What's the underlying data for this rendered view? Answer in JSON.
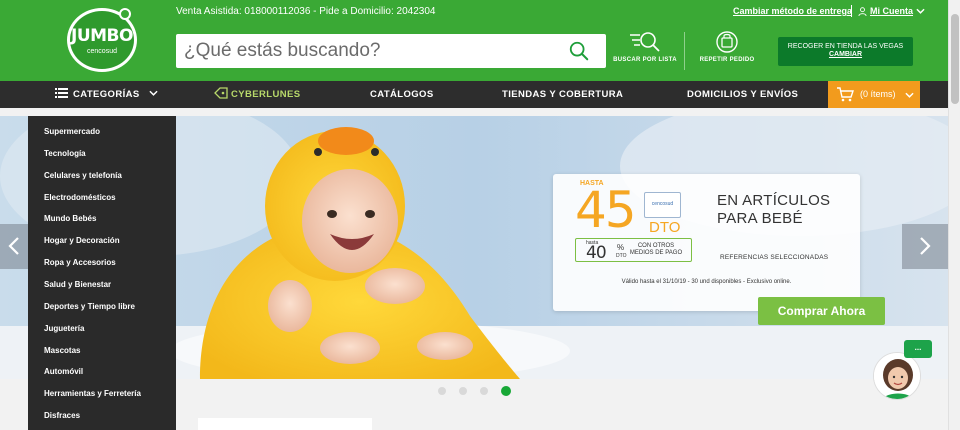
{
  "header": {
    "logo_text": "JUMBO",
    "logo_sub": "cencosud",
    "contact": "Venta Asistida: 018000112036 - Pide a Domicilio: 2042304",
    "delivery_link": "Cambiar método de entrega",
    "account_label": "Mi Cuenta",
    "search_placeholder": "¿Qué estás buscando?",
    "buy_by_list": "BUSCAR POR LISTA",
    "repeat_order": "REPETIR PEDIDO",
    "pickup_title": "RECOGER EN TIENDA LAS VEGAS",
    "pickup_change": "CAMBIAR"
  },
  "nav": {
    "categories": "CATEGORÍAS",
    "cyberlunes": "CYBERLUNES",
    "catalogs": "CATÁLOGOS",
    "stores": "TIENDAS Y COBERTURA",
    "delivery": "DOMICILIOS Y ENVÍOS",
    "cart": "(0 ítems)"
  },
  "sidebar": {
    "items": [
      "Supermercado",
      "Tecnología",
      "Celulares y telefonía",
      "Electrodomésticos",
      "Mundo Bebés",
      "Hogar y Decoración",
      "Ropa y Accesorios",
      "Salud y Bienestar",
      "Deportes y Tiempo libre",
      "Juguetería",
      "Mascotas",
      "Automóvil",
      "Herramientas y Ferretería",
      "Disfraces"
    ]
  },
  "promo": {
    "hasta": "HASTA",
    "big_percent": "45",
    "badge": "cencosud",
    "dto": "DTO",
    "other_hasta": "hasta",
    "other_percent": "40",
    "other_pct_sign": "%",
    "other_dto": "DTO",
    "other_methods": "CON OTROS MEDIOS DE PAGO",
    "title_line1": "EN ARTÍCULOS",
    "title_line2": "PARA BEBÉ",
    "references": "REFERENCIAS SELECCIONADAS",
    "validity": "Válido hasta el 31/10/19 - 30 und disponibles - Exclusivo online.",
    "button": "Comprar Ahora"
  },
  "carousel": {
    "slides": 4,
    "active_slide": 4
  },
  "chat": {
    "bubble": "..."
  },
  "colors": {
    "brand_green": "#3aa935",
    "nav_dark": "#2d2d2d",
    "cart_orange": "#f29b1d",
    "promo_orange": "#f5a623",
    "cta_green": "#7bc043"
  }
}
